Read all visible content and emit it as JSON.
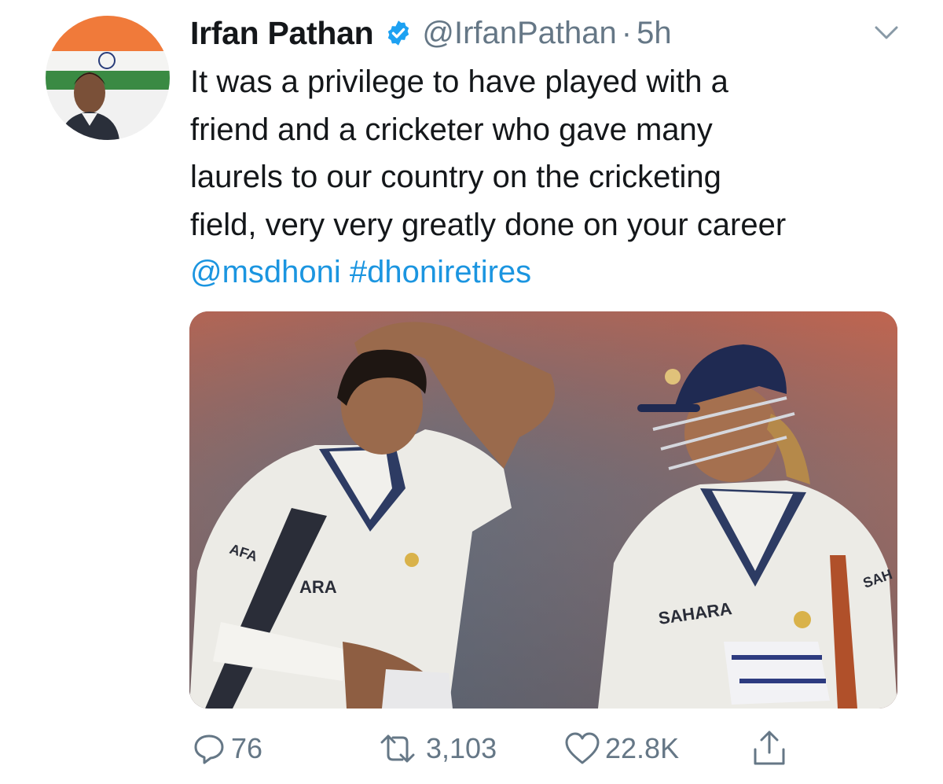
{
  "tweet": {
    "display_name": "Irfan Pathan",
    "handle": "@IrfanPathan",
    "separator": "·",
    "time": "5h",
    "verified": true,
    "text_lines": [
      "It was a privilege to have played with a",
      "friend and a cricketer who gave many",
      "laurels to our country on the cricketing",
      "field, very very greatly done on your career"
    ],
    "mention": "@msdhoni",
    "hashtag": "#dhoniretires"
  },
  "media": {
    "jersey_text_left": "ARA",
    "jersey_text_left_sleeve": "AFA",
    "jersey_text_right": "SAHARA",
    "jersey_text_right_sleeve": "SAH"
  },
  "actions": {
    "reply_count": "76",
    "retweet_count": "3,103",
    "like_count": "22.8K"
  },
  "colors": {
    "link": "#1b95e0",
    "secondary": "#657786",
    "verified": "#1da1f2"
  },
  "icons": {
    "verified": "verified-badge-icon",
    "more": "chevron-down-icon",
    "reply": "reply-icon",
    "retweet": "retweet-icon",
    "like": "heart-icon",
    "share": "share-icon"
  }
}
